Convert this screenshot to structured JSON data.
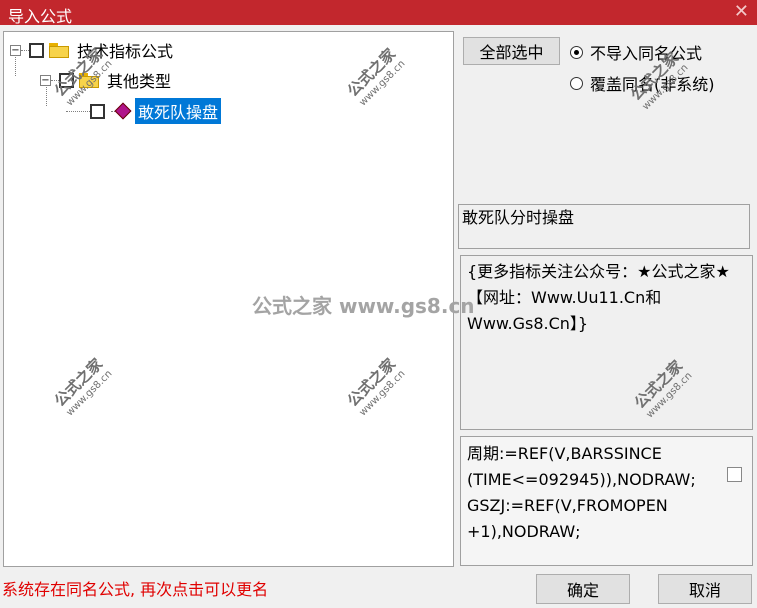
{
  "window": {
    "title": "导入公式",
    "close_glyph": "✕"
  },
  "tree": {
    "root": {
      "label": "技术指标公式",
      "expander": "−"
    },
    "group": {
      "label": "其他类型",
      "expander": "−"
    },
    "leaf": {
      "label": "敢死队操盘"
    }
  },
  "buttons": {
    "select_all": "全部选中",
    "ok": "确定",
    "cancel": "取消"
  },
  "options": {
    "no_import_same": "不导入同名公式",
    "overwrite_same": "覆盖同名(非系统)"
  },
  "formula_name": "敢死队分时操盘",
  "formula_description": "{更多指标关注公众号：★公式之家★ 【网址：Www.Uu11.Cn和Www.Gs8.Cn】}",
  "formula_code": [
    "周期:=REF(V,BARSSINCE",
    "(TIME<=092945)),NODRAW;",
    "GSZJ:=REF(V,FROMOPEN",
    "+1),NODRAW;"
  ],
  "status_message": "系统存在同名公式, 再次点击可以更名",
  "watermark": {
    "center": "公式之家 www.gs8.cn",
    "stamp_cn": "公式之家",
    "stamp_url": "www.gs8.cn"
  },
  "colors": {
    "titlebar": "#c2272d",
    "selection": "#0078d7",
    "status": "#e00000"
  }
}
